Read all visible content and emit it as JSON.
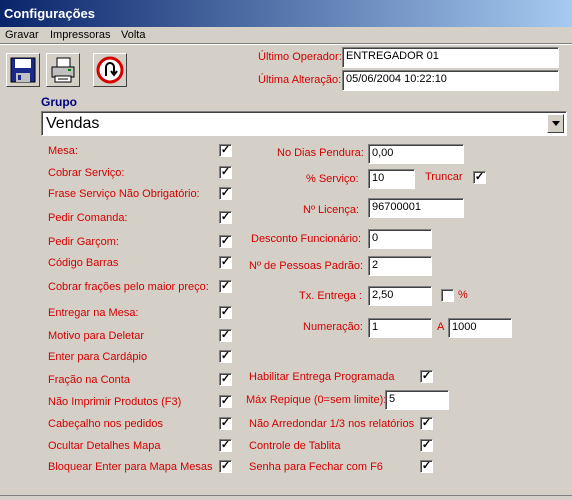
{
  "window": {
    "title": "Configurações"
  },
  "menu": [
    {
      "label": "Gravar"
    },
    {
      "label": "Impressoras"
    },
    {
      "label": "Volta"
    }
  ],
  "toolbar": [
    {
      "icon": "save-icon"
    },
    {
      "icon": "printer-icon"
    },
    {
      "icon": "undo-icon"
    }
  ],
  "header": {
    "operador_label": "Último Operador:",
    "operador_value": "ENTREGADOR 01",
    "alteracao_label": "Última Alteração:",
    "alteracao_value": "05/06/2004 10:22:10"
  },
  "grupo": {
    "label": "Grupo",
    "selected": "Vendas"
  },
  "left_options": [
    {
      "label": "Mesa:",
      "checked": true
    },
    {
      "label": "Cobrar Serviço:",
      "checked": true
    },
    {
      "label": "Frase Serviço Não Obrigatório:",
      "checked": true
    },
    {
      "label": "Pedir Comanda:",
      "checked": true
    },
    {
      "label": "Pedir Garçom:",
      "checked": true
    },
    {
      "label": "Código Barras",
      "checked": true
    },
    {
      "label": "Cobrar frações pelo maior preço:",
      "checked": true
    },
    {
      "label": "Entregar na Mesa:",
      "checked": true
    },
    {
      "label": "Motivo para Deletar",
      "checked": true
    },
    {
      "label": "Enter para Cardápio",
      "checked": true
    },
    {
      "label": "Fração na Conta",
      "checked": true
    },
    {
      "label": "Não Imprimir Produtos (F3)",
      "checked": true
    },
    {
      "label": "Cabeçalho nos pedidos",
      "checked": true
    },
    {
      "label": "Ocultar Detalhes Mapa",
      "checked": true
    },
    {
      "label": "Bloquear Enter para Mapa Mesas",
      "checked": true
    }
  ],
  "right_fields": {
    "dias_pendura_label": "No Dias Pendura:",
    "dias_pendura_value": "0,00",
    "servico_label": "% Serviço:",
    "servico_value": "10",
    "truncar_label": "Truncar",
    "truncar_checked": true,
    "licenca_label": "Nº Licença:",
    "licenca_value": "96700001",
    "desconto_label": "Desconto Funcionário:",
    "desconto_value": "0",
    "pessoas_label": "Nº de Pessoas Padrão:",
    "pessoas_value": "2",
    "entrega_label": "Tx. Entrega :",
    "entrega_value": "2,50",
    "entrega_pct_label": "%",
    "entrega_pct_checked": false,
    "numeracao_label": "Numeração:",
    "numeracao_from": "1",
    "numeracao_a_label": "A",
    "numeracao_to": "1000"
  },
  "right_options": {
    "hab_entrega_label": "Habilitar Entrega Programada",
    "hab_entrega_checked": true,
    "max_repique_label": "Máx Repique (0=sem limite):",
    "max_repique_value": "5",
    "nao_arred_label": "Não Arredondar 1/3 nos relatórios",
    "nao_arred_checked": true,
    "tablita_label": "Controle de Tablita",
    "tablita_checked": true,
    "senha_label": "Senha para Fechar com F6",
    "senha_checked": true
  },
  "colors": {
    "label_red": "#d40000",
    "group_blue": "#000080",
    "title_bar": "#0a246a"
  },
  "check_mark": "✓"
}
